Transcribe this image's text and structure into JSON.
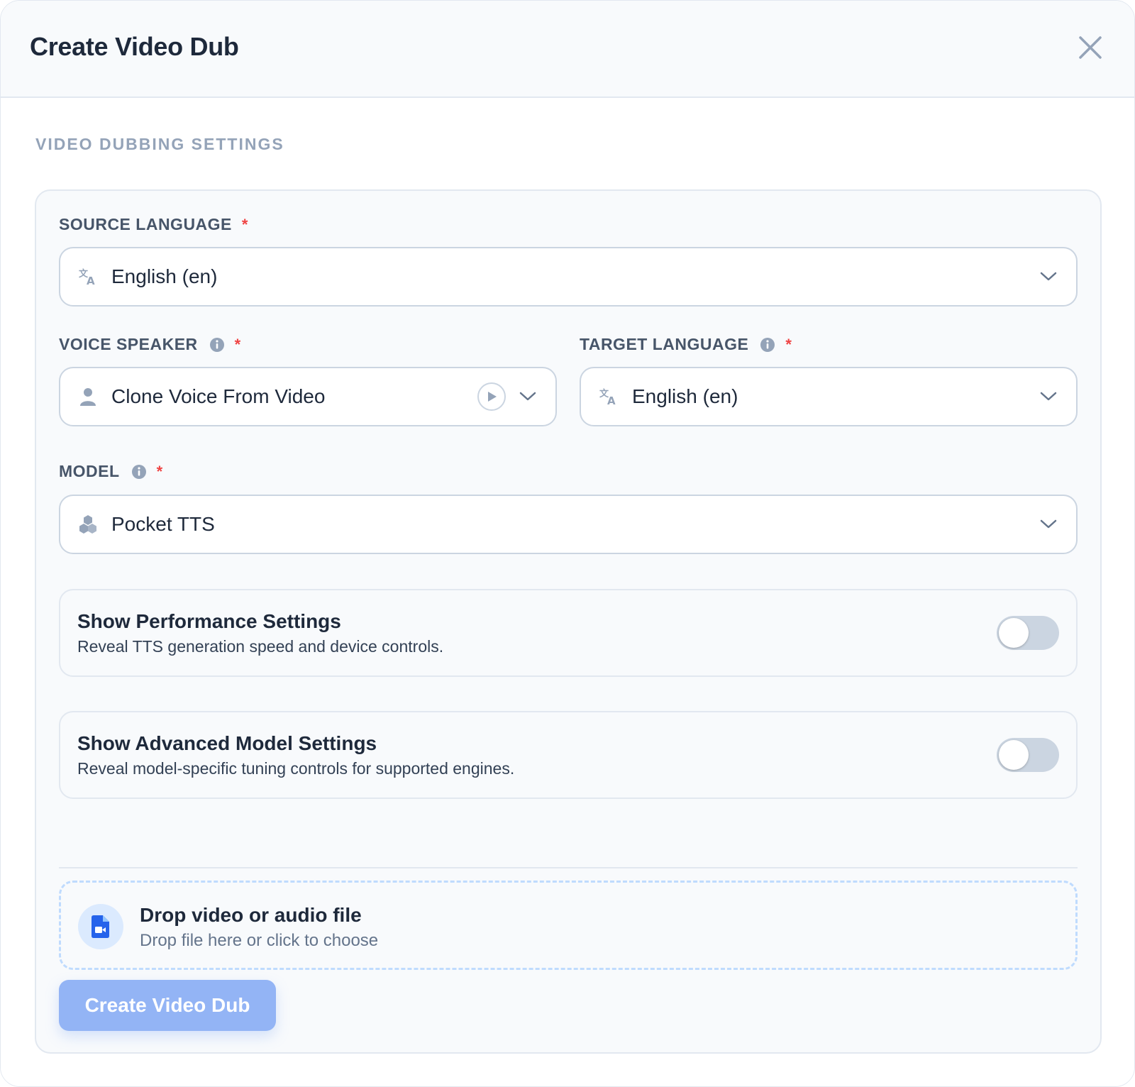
{
  "header": {
    "title": "Create Video Dub"
  },
  "section": {
    "title": "VIDEO DUBBING SETTINGS"
  },
  "source_language": {
    "label": "SOURCE LANGUAGE",
    "required_mark": "*",
    "value": "English (en)",
    "icon": "translate-icon"
  },
  "voice_speaker": {
    "label": "VOICE SPEAKER",
    "required_mark": "*",
    "value": "Clone Voice From Video",
    "icon": "person-icon"
  },
  "target_language": {
    "label": "TARGET LANGUAGE",
    "required_mark": "*",
    "value": "English (en)",
    "icon": "translate-icon"
  },
  "model": {
    "label": "MODEL",
    "required_mark": "*",
    "value": "Pocket TTS",
    "icon": "cubes-icon"
  },
  "performance_toggle": {
    "title": "Show Performance Settings",
    "description": "Reveal TTS generation speed and device controls.",
    "on": false
  },
  "advanced_toggle": {
    "title": "Show Advanced Model Settings",
    "description": "Reveal model-specific tuning controls for supported engines.",
    "on": false
  },
  "dropzone": {
    "title": "Drop video or audio file",
    "subtitle": "Drop file here or click to choose"
  },
  "submit": {
    "label": "Create Video Dub"
  },
  "colors": {
    "accent": "#2563eb",
    "required": "#ef4444",
    "button": "#93b4f5",
    "dropzone_border": "#bfdbfe"
  }
}
